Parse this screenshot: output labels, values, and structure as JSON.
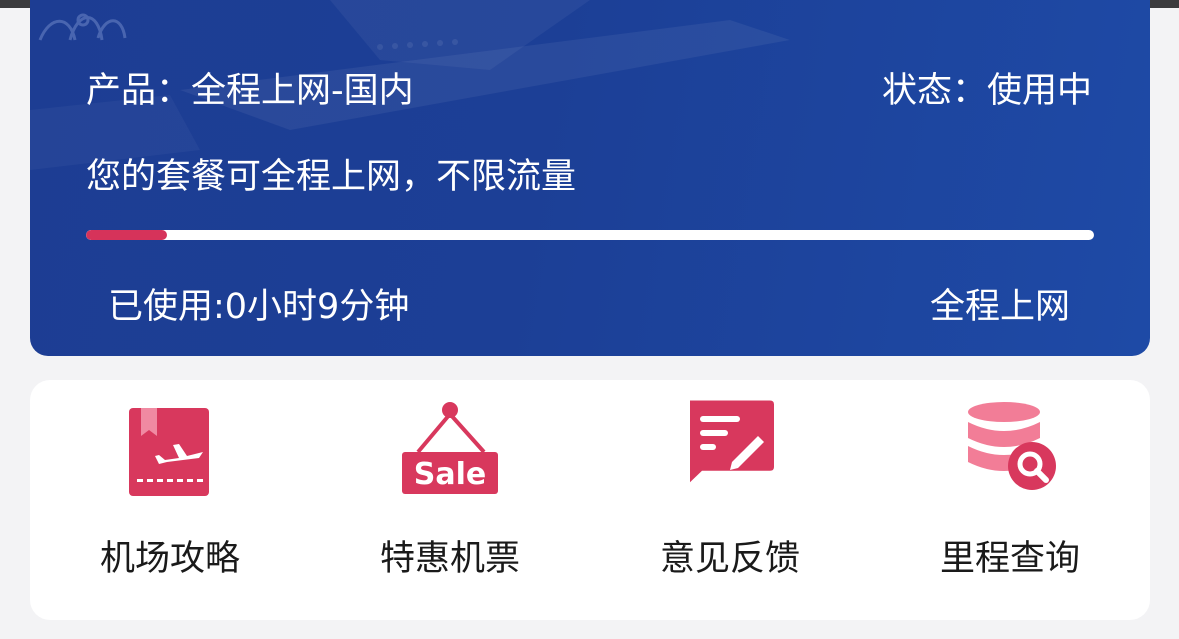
{
  "plan": {
    "product_label": "产品：全程上网-国内",
    "status_label": "状态：使用中",
    "description": "您的套餐可全程上网，不限流量",
    "usage_progress_percent": 8,
    "used_time": "已使用:0小时9分钟",
    "plan_type": "全程上网"
  },
  "colors": {
    "card_blue": "#1d3d93",
    "accent_red": "#d6335a"
  },
  "services": [
    {
      "label": "机场攻略",
      "icon": "airport-guide-icon"
    },
    {
      "label": "特惠机票",
      "icon": "sale-tag-icon"
    },
    {
      "label": "意见反馈",
      "icon": "feedback-icon"
    },
    {
      "label": "里程查询",
      "icon": "mileage-search-icon"
    }
  ]
}
